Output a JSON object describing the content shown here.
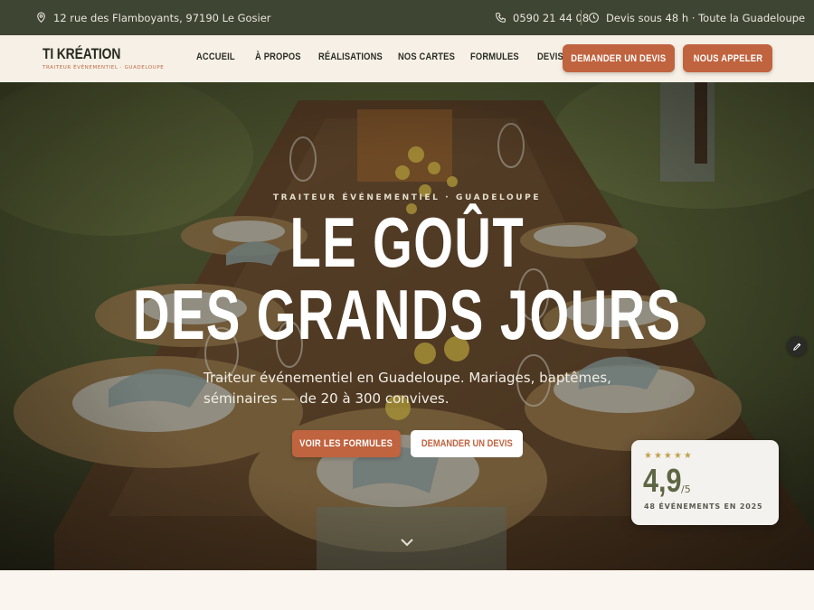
{
  "topbar": {
    "address": "12 rue des Flamboyants, 97190 Le Gosier",
    "phone": "0590 21 44 08",
    "delay": "Devis sous 48 h · Toute la Guadeloupe",
    "icons": [
      "location-pin-icon",
      "phone-icon",
      "clock-icon"
    ]
  },
  "brand": {
    "name": "TI KRÉATION",
    "tagline": "TRAITEUR ÉVÉNEMENTIEL · GUADELOUPE"
  },
  "nav": {
    "links": [
      "ACCUEIL",
      "À PROPOS",
      "RÉALISATIONS",
      "NOS CARTES",
      "FORMULES",
      "DEVIS"
    ],
    "quote_button": "DEMANDER UN DEVIS",
    "call_button": "NOUS APPELER"
  },
  "hero": {
    "eyebrow": "TRAITEUR ÉVÉNEMENTIEL · GUADELOUPE",
    "title_line1": "LE GOÛT",
    "title_line2": "DES GRANDS JOURS",
    "lead": "Traiteur événementiel en Guadeloupe. Mariages, baptêmes, séminaires — de 20 à 300 convives.",
    "primary_cta": "VOIR LES FORMULES",
    "secondary_cta": "DEMANDER UN DEVIS",
    "scroll_icon": "chevron-down-icon"
  },
  "rating": {
    "stars": "★★★★★",
    "star_count": 5,
    "score": "4,9",
    "max": "/5",
    "caption": "48 ÉVÉNEMENTS EN 2025"
  },
  "colors": {
    "topbar_bg": "#3f4533",
    "nav_bg": "#f6f0e6",
    "accent": "#c0633f",
    "rating_text": "#5e6744",
    "star": "#c0a24f"
  }
}
